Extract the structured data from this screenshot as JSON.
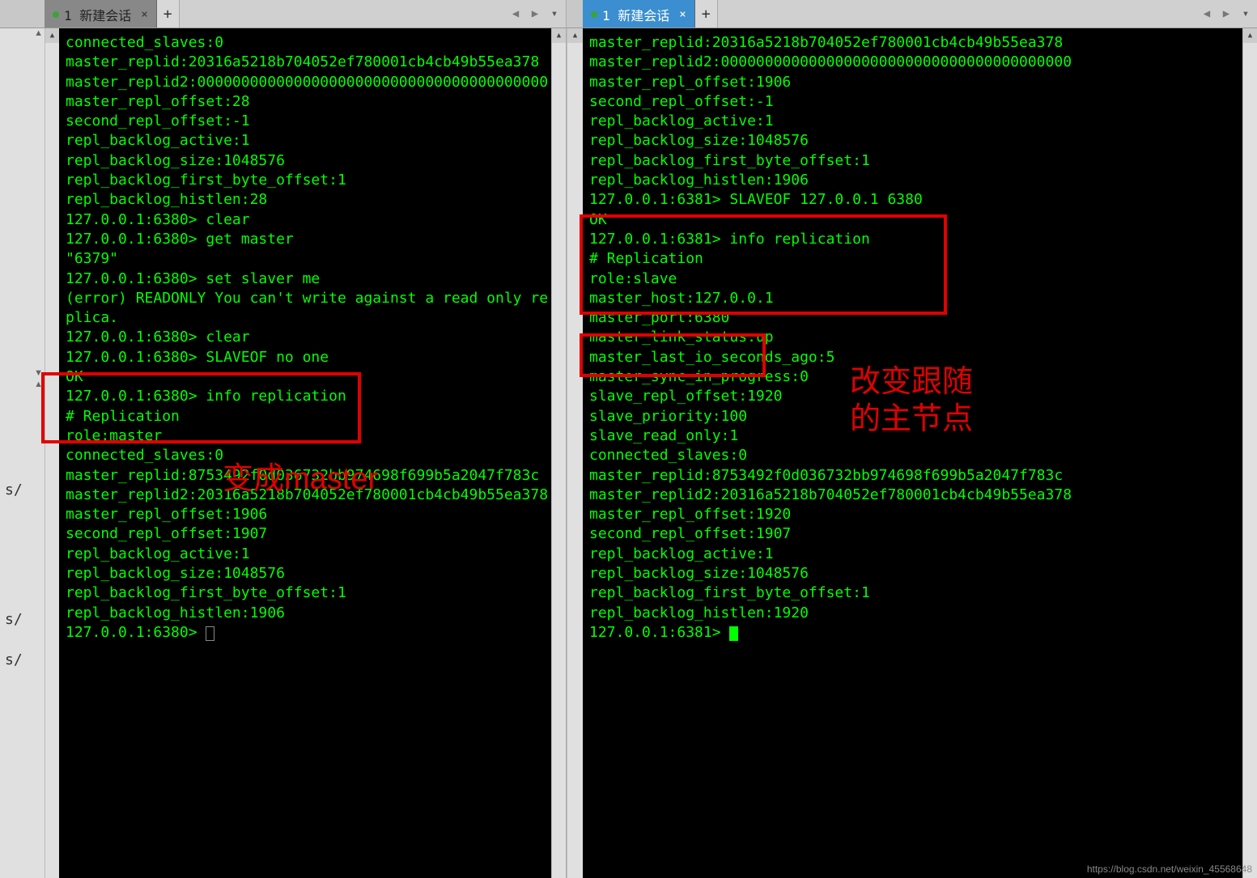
{
  "tab_label": "1 新建会话",
  "add_tab_label": "+",
  "left_terminal_lines": [
    "connected_slaves:0",
    "master_replid:20316a5218b704052ef780001cb4cb49b55ea378",
    "master_replid2:0000000000000000000000000000000000000000",
    "master_repl_offset:28",
    "second_repl_offset:-1",
    "repl_backlog_active:1",
    "repl_backlog_size:1048576",
    "repl_backlog_first_byte_offset:1",
    "repl_backlog_histlen:28",
    "127.0.0.1:6380> clear",
    "127.0.0.1:6380> get master",
    "\"6379\"",
    "127.0.0.1:6380> set slaver me",
    "(error) READONLY You can't write against a read only replica.",
    "127.0.0.1:6380> clear",
    "127.0.0.1:6380> SLAVEOF no one",
    "OK",
    "127.0.0.1:6380> info replication",
    "# Replication",
    "role:master",
    "connected_slaves:0",
    "master_replid:8753492f0d036732bb974698f699b5a2047f783c",
    "master_replid2:20316a5218b704052ef780001cb4cb49b55ea378",
    "master_repl_offset:1906",
    "second_repl_offset:1907",
    "repl_backlog_active:1",
    "repl_backlog_size:1048576",
    "repl_backlog_first_byte_offset:1",
    "repl_backlog_histlen:1906"
  ],
  "left_prompt": "127.0.0.1:6380> ",
  "right_terminal_lines": [
    "master_replid:20316a5218b704052ef780001cb4cb49b55ea378",
    "master_replid2:0000000000000000000000000000000000000000",
    "master_repl_offset:1906",
    "second_repl_offset:-1",
    "repl_backlog_active:1",
    "repl_backlog_size:1048576",
    "repl_backlog_first_byte_offset:1",
    "repl_backlog_histlen:1906",
    "127.0.0.1:6381> SLAVEOF 127.0.0.1 6380",
    "OK",
    "127.0.0.1:6381> info replication",
    "# Replication",
    "role:slave",
    "master_host:127.0.0.1",
    "master_port:6380",
    "master_link_status:up",
    "master_last_io_seconds_ago:5",
    "master_sync_in_progress:0",
    "slave_repl_offset:1920",
    "slave_priority:100",
    "slave_read_only:1",
    "connected_slaves:0",
    "master_replid:8753492f0d036732bb974698f699b5a2047f783c",
    "master_replid2:20316a5218b704052ef780001cb4cb49b55ea378",
    "master_repl_offset:1920",
    "second_repl_offset:1907",
    "repl_backlog_active:1",
    "repl_backlog_size:1048576",
    "repl_backlog_first_byte_offset:1",
    "repl_backlog_histlen:1920"
  ],
  "right_prompt": "127.0.0.1:6381> ",
  "anno_left": "变成master",
  "anno_right_l1": "改变跟随",
  "anno_right_l2": "的主节点",
  "left_gutter": {
    "items": [
      "s/",
      "s/",
      "s/"
    ]
  },
  "watermark": "https://blog.csdn.net/weixin_45568648"
}
